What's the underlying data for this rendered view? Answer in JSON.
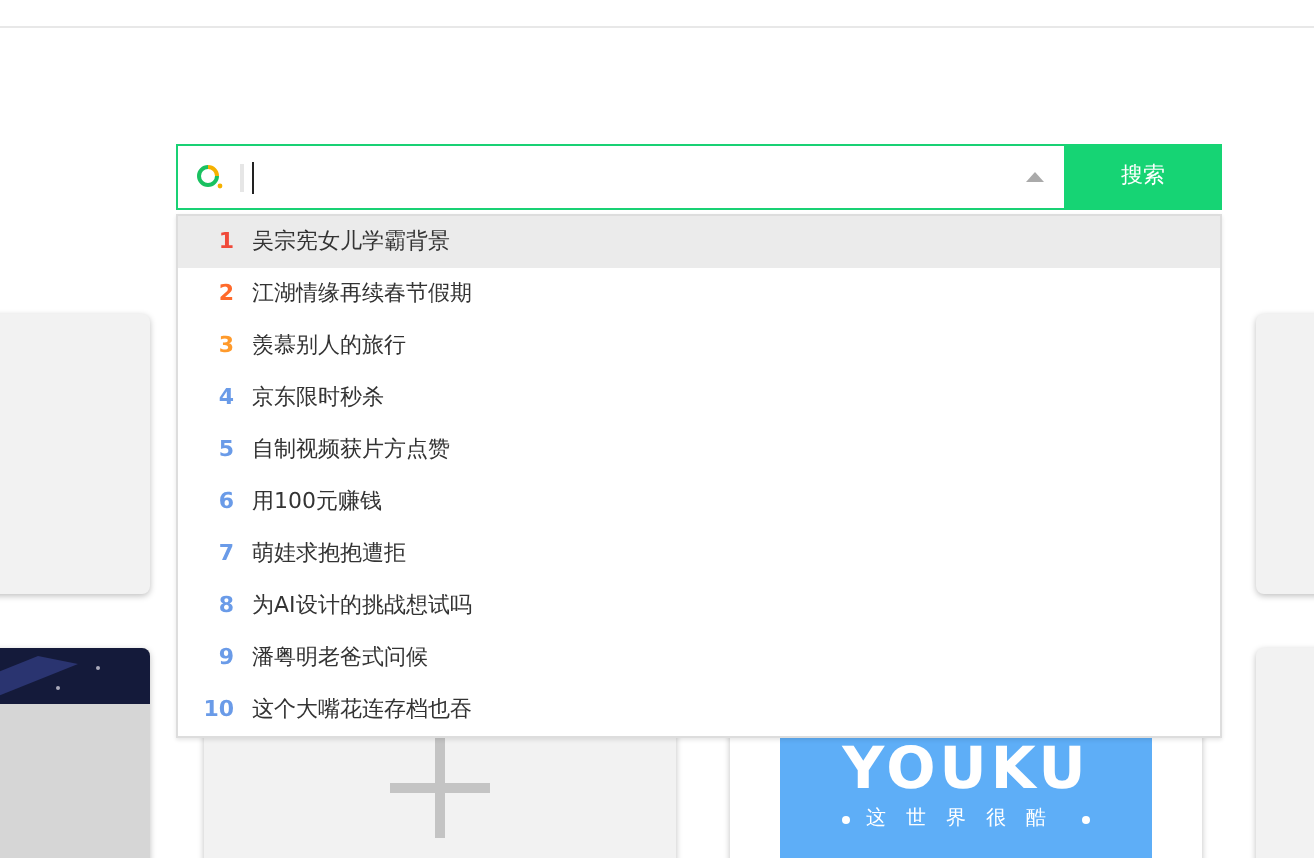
{
  "search": {
    "button": "搜索"
  },
  "suggestions": [
    {
      "rank": "1",
      "text": "吴宗宪女儿学霸背景",
      "color": "#f04a3a",
      "selected": true
    },
    {
      "rank": "2",
      "text": "江湖情缘再续春节假期",
      "color": "#ff6a2b",
      "selected": false
    },
    {
      "rank": "3",
      "text": "羡慕别人的旅行",
      "color": "#ff9a2b",
      "selected": false
    },
    {
      "rank": "4",
      "text": "京东限时秒杀",
      "color": "#6a9be8",
      "selected": false
    },
    {
      "rank": "5",
      "text": "自制视频获片方点赞",
      "color": "#6a9be8",
      "selected": false
    },
    {
      "rank": "6",
      "text": "用100元赚钱",
      "color": "#6a9be8",
      "selected": false
    },
    {
      "rank": "7",
      "text": "萌娃求抱抱遭拒",
      "color": "#6a9be8",
      "selected": false
    },
    {
      "rank": "8",
      "text": "为AI设计的挑战想试吗",
      "color": "#6a9be8",
      "selected": false
    },
    {
      "rank": "9",
      "text": "潘粤明老爸式问候",
      "color": "#6a9be8",
      "selected": false
    },
    {
      "rank": "10",
      "text": "这个大嘴花连存档也吞",
      "color": "#6a9be8",
      "selected": false
    }
  ],
  "top_row": [
    {
      "kind": "blank"
    },
    {
      "kind": "blank"
    }
  ],
  "tiles": [
    {
      "kind": "picture"
    },
    {
      "kind": "add"
    },
    {
      "kind": "logo",
      "title": "YOUKU",
      "slogan": "这世界很酷"
    },
    {
      "kind": "blank"
    }
  ]
}
